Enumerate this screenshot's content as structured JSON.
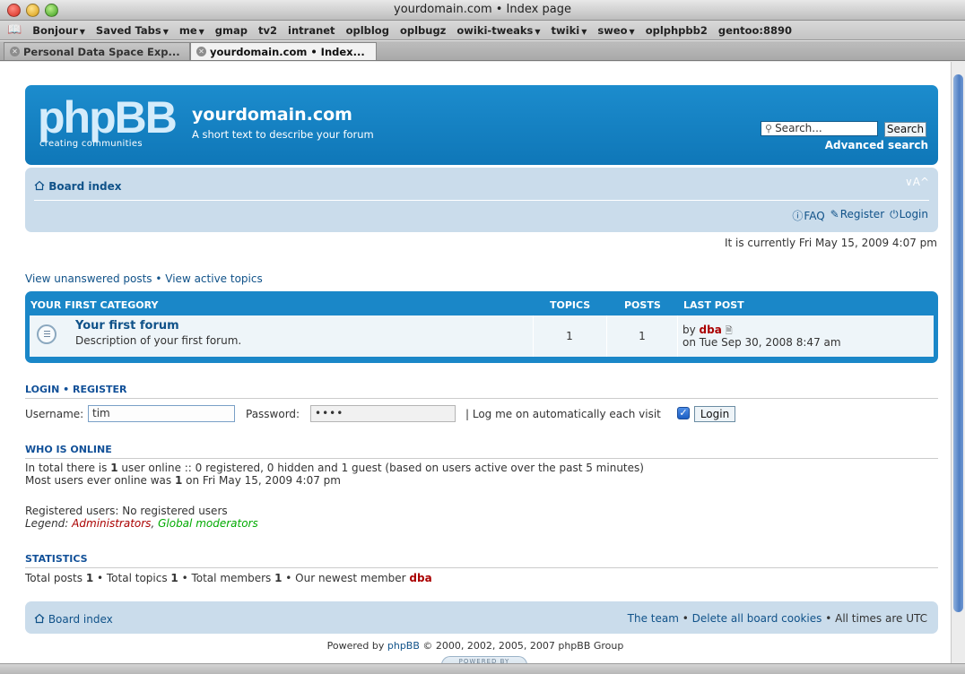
{
  "browser": {
    "window_title": "yourdomain.com • Index page",
    "bookmarks": [
      {
        "label": "Bonjour",
        "menu": true
      },
      {
        "label": "Saved Tabs",
        "menu": true
      },
      {
        "label": "me",
        "menu": true
      },
      {
        "label": "gmap",
        "menu": false
      },
      {
        "label": "tv2",
        "menu": false
      },
      {
        "label": "intranet",
        "menu": false
      },
      {
        "label": "oplblog",
        "menu": false
      },
      {
        "label": "oplbugz",
        "menu": false
      },
      {
        "label": "owiki-tweaks",
        "menu": true
      },
      {
        "label": "twiki",
        "menu": true
      },
      {
        "label": "sweo",
        "menu": true
      },
      {
        "label": "oplphpbb2",
        "menu": false
      },
      {
        "label": "gentoo:8890",
        "menu": false
      }
    ],
    "tabs": [
      {
        "label": "Personal Data Space Exp...",
        "active": false
      },
      {
        "label": "yourdomain.com • Index...",
        "active": true
      }
    ]
  },
  "header": {
    "logo_text": "phpBB",
    "logo_tagline": "creating  communities",
    "site_title": "yourdomain.com",
    "site_description": "A short text to describe your forum",
    "search_placeholder": "Search...",
    "search_button": "Search",
    "advanced_search": "Advanced search"
  },
  "navbar": {
    "board_index": "Board index",
    "font_size": "∨A^",
    "faq": "FAQ",
    "register": "Register",
    "login": "Login"
  },
  "current_time": "It is currently Fri May 15, 2009 4:07 pm",
  "view_links": {
    "unanswered": "View unanswered posts",
    "active": "View active topics",
    "separator": " • "
  },
  "forum_table": {
    "headers": {
      "category": "YOUR FIRST CATEGORY",
      "topics": "TOPICS",
      "posts": "POSTS",
      "last_post": "LAST POST"
    },
    "forums": [
      {
        "title": "Your first forum",
        "description": "Description of your first forum.",
        "topics": "1",
        "posts": "1",
        "last_post_by_prefix": "by",
        "last_post_author": "dba",
        "last_post_date": "on Tue Sep 30, 2008 8:47 am"
      }
    ]
  },
  "login": {
    "heading": "LOGIN  •  REGISTER",
    "username_label": "Username:",
    "username_value": "tim",
    "password_label": "Password:",
    "password_value": "••••",
    "autologin_label": "| Log me on automatically each visit",
    "login_button": "Login"
  },
  "who_is_online": {
    "heading": "WHO IS ONLINE",
    "line1_prefix": "In total there is ",
    "line1_count": "1",
    "line1_suffix": " user online :: 0 registered, 0 hidden and 1 guest (based on users active over the past 5 minutes)",
    "line2_prefix": "Most users ever online was ",
    "line2_count": "1",
    "line2_suffix": " on Fri May 15, 2009 4:07 pm",
    "registered_users": "Registered users: No registered users",
    "legend_label": "Legend:",
    "legend_admins": "Administrators",
    "legend_comma": ",",
    "legend_mods": "Global moderators"
  },
  "statistics": {
    "heading": "STATISTICS",
    "posts_label": "Total posts ",
    "posts_value": "1",
    "topics_label": " • Total topics ",
    "topics_value": "1",
    "members_label": " • Total members ",
    "members_value": "1",
    "newest_label": " • Our newest member ",
    "newest_value": "dba"
  },
  "footer": {
    "board_index": "Board index",
    "team": "The team",
    "sep": " • ",
    "delete_cookies": "Delete all board cookies",
    "timezone": "All times are UTC",
    "powered_prefix": "Powered by ",
    "powered_link": "phpBB",
    "powered_suffix": " © 2000, 2002, 2005, 2007 phpBB Group",
    "badge_text": "POWERED BY"
  },
  "colors": {
    "header_blue": "#1686c9",
    "nav_light_blue": "#cadceb",
    "link_blue": "#105289",
    "admin_red": "#aa0000",
    "mod_green": "#00aa00"
  }
}
